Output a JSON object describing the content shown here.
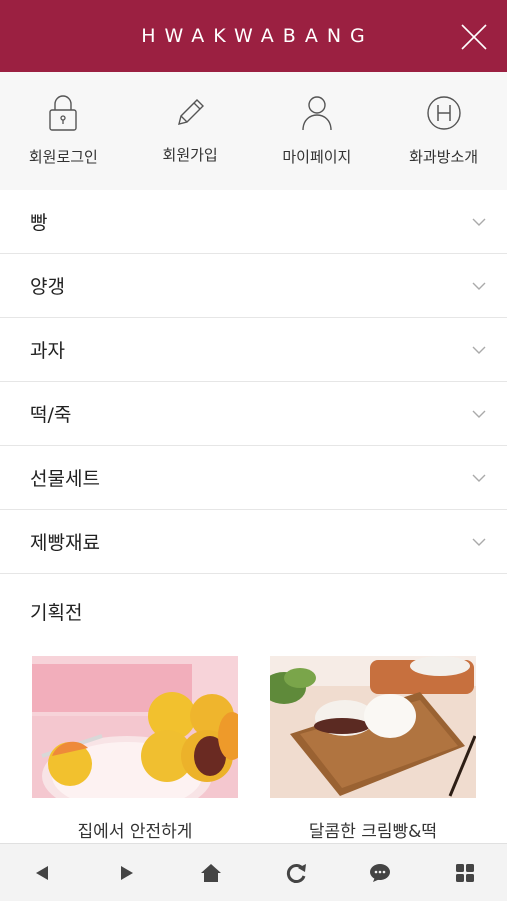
{
  "header": {
    "brand": "HWAKWABANG",
    "close_icon": "close-icon",
    "color": "#9b2041"
  },
  "quick_links": [
    {
      "label": "회원로그인",
      "icon": "lock-icon"
    },
    {
      "label": "회원가입",
      "icon": "pencil-icon"
    },
    {
      "label": "마이페이지",
      "icon": "user-icon"
    },
    {
      "label": "화과방소개",
      "icon": "h-circle-icon"
    }
  ],
  "menu": [
    {
      "label": "빵"
    },
    {
      "label": "양갱"
    },
    {
      "label": "과자"
    },
    {
      "label": "떡/죽"
    },
    {
      "label": "선물세트"
    },
    {
      "label": "제빵재료"
    }
  ],
  "promotion": {
    "title": "기획전",
    "items": [
      {
        "caption": "집에서 안전하게"
      },
      {
        "caption": "달콤한 크림빵&떡"
      }
    ]
  },
  "bottom_bar": [
    "back-icon",
    "forward-icon",
    "home-icon",
    "refresh-icon",
    "chat-icon",
    "grid-icon"
  ]
}
